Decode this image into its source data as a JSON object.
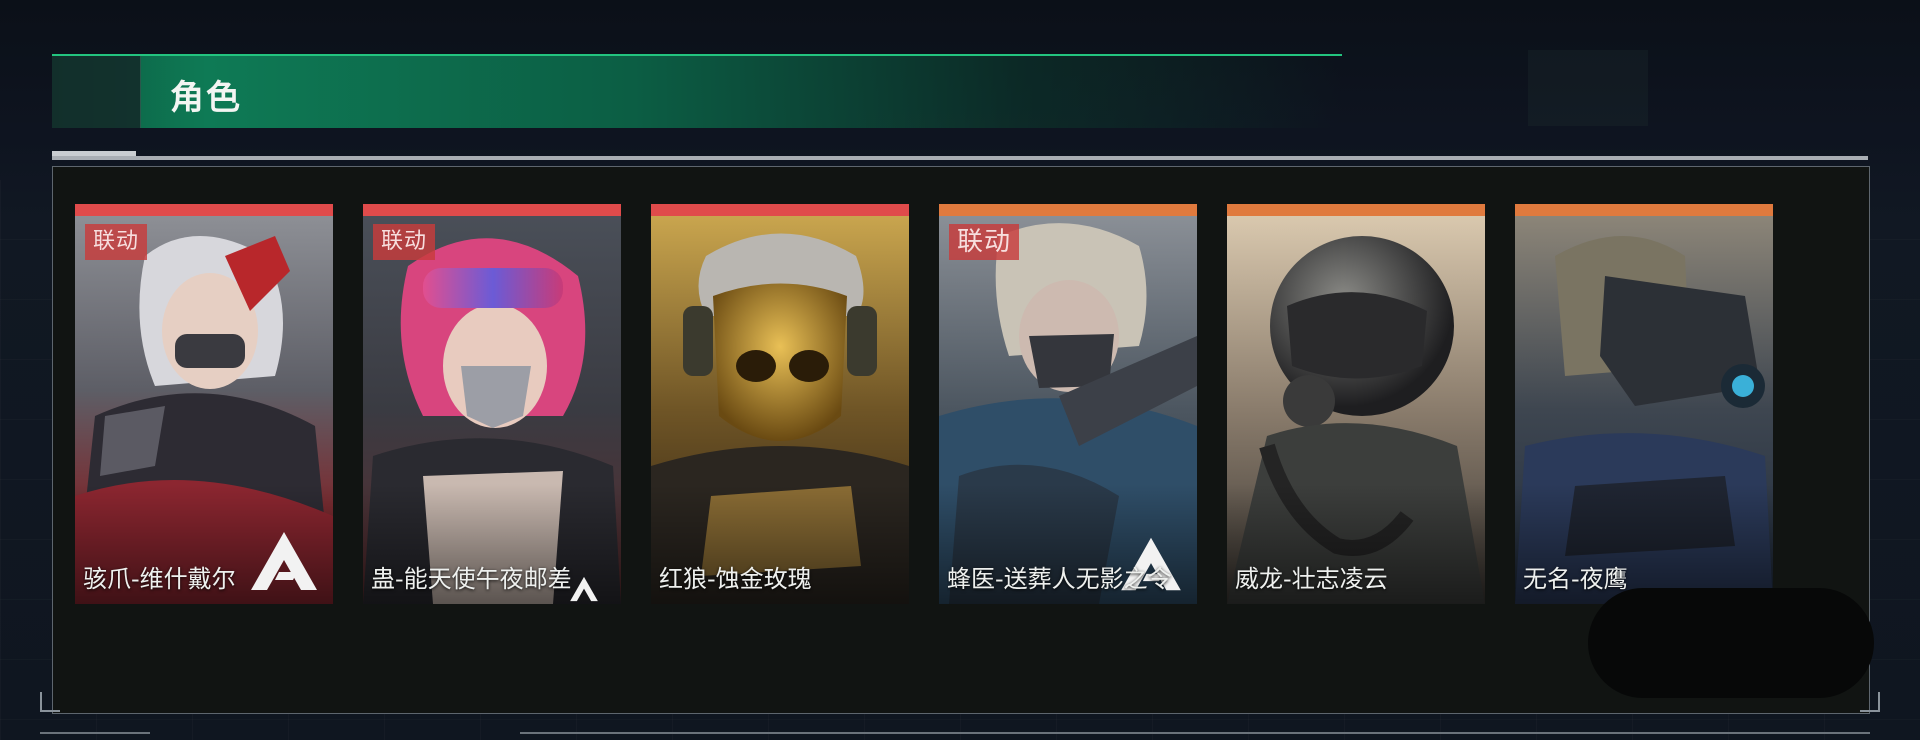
{
  "header": {
    "title": "角色"
  },
  "characters": [
    {
      "name": "骇爪-维什戴尔",
      "badge": "联动",
      "rarity_color": "#e04b4b",
      "has_logo": true
    },
    {
      "name": "蛊-能天使午夜邮差",
      "badge": "联动",
      "rarity_color": "#e04b4b",
      "has_logo": true
    },
    {
      "name": "红狼-蚀金玫瑰",
      "badge": "",
      "rarity_color": "#e04b4b",
      "has_logo": false
    },
    {
      "name": "蜂医-送葬人无影之令",
      "badge": "联动",
      "rarity_color": "#e07a3e",
      "has_logo": true
    },
    {
      "name": "威龙-壮志凌云",
      "badge": "",
      "rarity_color": "#e07a3e",
      "has_logo": false
    },
    {
      "name": "无名-夜鹰",
      "badge": "",
      "rarity_color": "#e07a3e",
      "has_logo": false
    }
  ]
}
